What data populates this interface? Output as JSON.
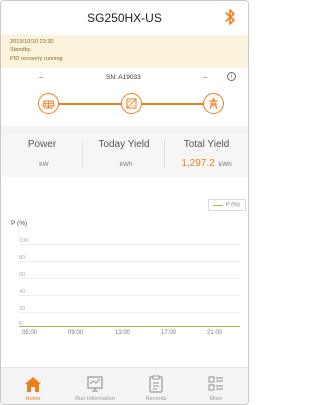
{
  "header": {
    "title": "SG250HX-US",
    "bluetooth_icon": "bluetooth-icon",
    "accent": "#ef7f1a"
  },
  "status": {
    "datetime": "2019/10/10  23:30",
    "state": "Standby",
    "message": "PID recovery running"
  },
  "flow": {
    "left_value": "--",
    "serial": "SN: A19033",
    "right_value": "-- ",
    "info_icon": "info-icon",
    "nodes": [
      "solar-panel-icon",
      "inverter-icon",
      "grid-tower-icon"
    ]
  },
  "stats": {
    "power": {
      "label": "Power",
      "value": "",
      "unit": "kW"
    },
    "today_yield": {
      "label": "Today Yield",
      "value": "",
      "unit": "kWh"
    },
    "total_yield": {
      "label": "Total Yield",
      "value": "1,297.2",
      "unit": "kWh"
    }
  },
  "chart_data": {
    "type": "line",
    "ylabel": "P (%)",
    "yticks": [
      "100",
      "80",
      "60",
      "40",
      "20",
      "0"
    ],
    "ylim": [
      0,
      100
    ],
    "x_ticks": [
      "05:00",
      "09:00",
      "13:00",
      "17:00",
      "21:00"
    ],
    "series": [
      {
        "name": "P (%)",
        "color": "#a5b84a",
        "x": [
          "05:00",
          "09:00",
          "13:00",
          "17:00",
          "21:00"
        ],
        "values": [
          0,
          0,
          0,
          0,
          0
        ]
      }
    ],
    "legend_position": "top-right",
    "grid": true
  },
  "tabs": [
    {
      "label": "Home",
      "icon": "home-icon",
      "active": true
    },
    {
      "label": "Run Information",
      "icon": "monitor-icon",
      "active": false
    },
    {
      "label": "Records",
      "icon": "clipboard-icon",
      "active": false
    },
    {
      "label": "More",
      "icon": "grid-menu-icon",
      "active": false
    }
  ]
}
